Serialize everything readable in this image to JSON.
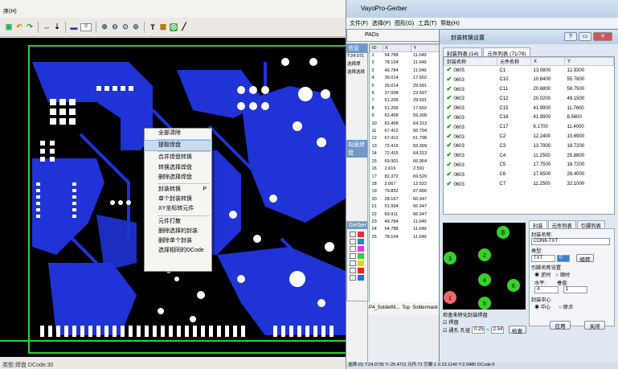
{
  "left_app": {
    "menu": "序(H)",
    "zoom_value": "0",
    "status": "类型:焊盘 DCode:30"
  },
  "context_menu": {
    "items": [
      "全部清除",
      "提取焊盘",
      "合并焊盘转换",
      "转换选择焊盘",
      "删除选择焊盘",
      "封装转换",
      "单个封装转换",
      "XY坐标转元件",
      "元件打散",
      "删除选择的封装",
      "删除单个封装",
      "选择相同的DCode"
    ],
    "shortcut": "P"
  },
  "right_app": {
    "title": "VayoPro-Gerber",
    "menu": "文件(F) 选择(P) 图形(G) 工具(T) 帮助(H)",
    "pads_tab": "PADs",
    "left_strip": {
      "header": "信息",
      "lines": [
        "T:24 071",
        "选择焊",
        "选择选择"
      ],
      "green": "勾画焊盘",
      "gerber": "Gerber"
    },
    "pad_table": {
      "columns": [
        "ID",
        "X",
        "Y"
      ],
      "rows": [
        [
          "1",
          "54.788",
          "11.049"
        ],
        [
          "2",
          "78.104",
          "11.049"
        ],
        [
          "3",
          "49.784",
          "11.049"
        ],
        [
          "4",
          "39.014",
          "17.602"
        ],
        [
          "5",
          "39.014",
          "29.591"
        ],
        [
          "6",
          "37.008",
          "23.597"
        ],
        [
          "7",
          "51.206",
          "29.591"
        ],
        [
          "8",
          "51.206",
          "17.602"
        ],
        [
          "9",
          "62.408",
          "59.309"
        ],
        [
          "10",
          "62.408",
          "64.313"
        ],
        [
          "11",
          "67.412",
          "56.794"
        ],
        [
          "12",
          "67.412",
          "61.798"
        ],
        [
          "13",
          "72.415",
          "59.309"
        ],
        [
          "14",
          "72.415",
          "64.313"
        ],
        [
          "15",
          "69.901",
          "66.954"
        ],
        [
          "16",
          "2.616",
          "2.591"
        ],
        [
          "17",
          "82.372",
          "69.520"
        ],
        [
          "18",
          "2.667",
          "12.522"
        ],
        [
          "19",
          "79.832",
          "67.666"
        ],
        [
          "20",
          "28.167",
          "66.947"
        ],
        [
          "21",
          "51.994",
          "66.947"
        ],
        [
          "22",
          "69.911",
          "66.947"
        ],
        [
          "23",
          "49.784",
          "11.049"
        ],
        [
          "24",
          "54.788",
          "11.049"
        ],
        [
          "25",
          "78.104",
          "11.049"
        ]
      ]
    },
    "layer_bar": [
      "P4_SolderM...",
      "Top",
      "Soldermask"
    ]
  },
  "dialog": {
    "title": "封装转换设置",
    "tabs": [
      "封装列表 (14)",
      "元件列表 (71/78)"
    ],
    "columns": [
      "封装名称",
      "元件名称",
      "X",
      "Y"
    ],
    "rows": [
      [
        "0805",
        "C1",
        "13.0800",
        "12.9300"
      ],
      [
        "0603",
        "C10",
        "10.6400",
        "55.7800"
      ],
      [
        "0603",
        "C11",
        "20.6800",
        "58.7500"
      ],
      [
        "0603",
        "C12",
        "20.0200",
        "49.1500"
      ],
      [
        "0603",
        "C15",
        "41.9900",
        "11.7600"
      ],
      [
        "0603",
        "C16",
        "41.9900",
        "8.5600"
      ],
      [
        "0603",
        "C17",
        "6.1700",
        "11.4000"
      ],
      [
        "0603",
        "C2",
        "12.2400",
        "10.6900"
      ],
      [
        "0603",
        "C3",
        "13.7900",
        "18.7200"
      ],
      [
        "0603",
        "C4",
        "11.2500",
        "25.8800"
      ],
      [
        "0603",
        "C5",
        "17.7500",
        "18.7200"
      ],
      [
        "0603",
        "C6",
        "17.6500",
        "28.4000"
      ],
      [
        "0603",
        "C7",
        "11.2500",
        "32.1000"
      ]
    ],
    "preview_pins": [
      "8",
      "1",
      "2",
      "3",
      "4",
      "5",
      "6",
      "7"
    ],
    "right_tabs": [
      "封装",
      "元件列表",
      "引脚列表"
    ],
    "package_name_label": "封装名称:",
    "package_name_value": "CON6-TXT",
    "type_label": "类型:",
    "type_value": "TXT",
    "type_num": "0",
    "build_btn": "组转",
    "pin_name_label": "引脚名称设置",
    "radio_clockwise": "顺时",
    "radio_counter": "逆时",
    "horiz_label": "水平:",
    "vert_label": "垂直:",
    "horiz_value": "A",
    "vert_value": "1",
    "center_label": "封装中心",
    "center_opt1": "中心",
    "center_opt2": "原点",
    "check_group": "检查未转化封装焊盘",
    "chk_pad": "焊盘",
    "chk_hole": "通孔",
    "hole_label": "孔径",
    "hole_from": "0.25",
    "hole_to": "2.54",
    "check_btn": "检查",
    "apply_btn": "应用",
    "close_btn": "关闭"
  },
  "right_status": "选择:(0) T:24.0735 Y:-25.4711 元件:71 引脚:1 X:23.1140 Y:2.0480 DCode:9",
  "colors": {
    "board": "#000000",
    "copper": "#1f33d6",
    "outline": "#2ed12e",
    "pad": "#ffffff",
    "pin": "#37d12a",
    "pin1": "#f06a6a"
  }
}
